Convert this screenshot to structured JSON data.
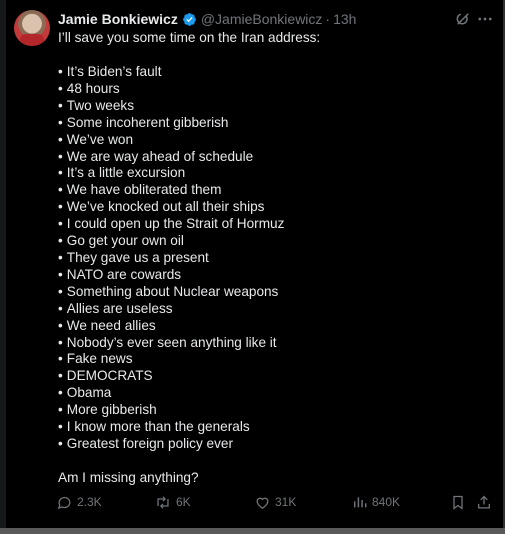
{
  "author": {
    "name": "Jamie Bonkiewicz",
    "handle": "@JamieBonkiewicz",
    "time": "13h",
    "separator": "·"
  },
  "post": {
    "intro": "I’ll save you some time on the Iran address:",
    "bullet_char": "•",
    "bullets": [
      "It’s Biden’s fault",
      "48 hours",
      "Two weeks",
      "Some incoherent gibberish",
      "We’ve won",
      "We are way ahead of schedule",
      "It’s a little excursion",
      "We have obliterated them",
      "We’ve knocked out all their ships",
      "I could open up the Strait of Hormuz",
      "Go get your own oil",
      "They gave us a present",
      "NATO are cowards",
      "Something about Nuclear weapons",
      "Allies are useless",
      "We need allies",
      "Nobody’s ever seen anything like it",
      "Fake news",
      "DEMOCRATS",
      "Obama",
      "More gibberish",
      "I know more than the generals",
      "Greatest foreign policy ever"
    ],
    "outro": "Am I missing anything?"
  },
  "actions": {
    "replies": "2.3K",
    "reposts": "6K",
    "likes": "31K",
    "views": "840K"
  },
  "colors": {
    "background": "#000000",
    "text": "#e7e9ea",
    "secondary": "#71767b",
    "verified": "#1d9bf0"
  },
  "icons": [
    "verified-badge-icon",
    "grok-icon",
    "more-icon",
    "reply-icon",
    "repost-icon",
    "like-icon",
    "views-icon",
    "bookmark-icon",
    "share-icon"
  ]
}
